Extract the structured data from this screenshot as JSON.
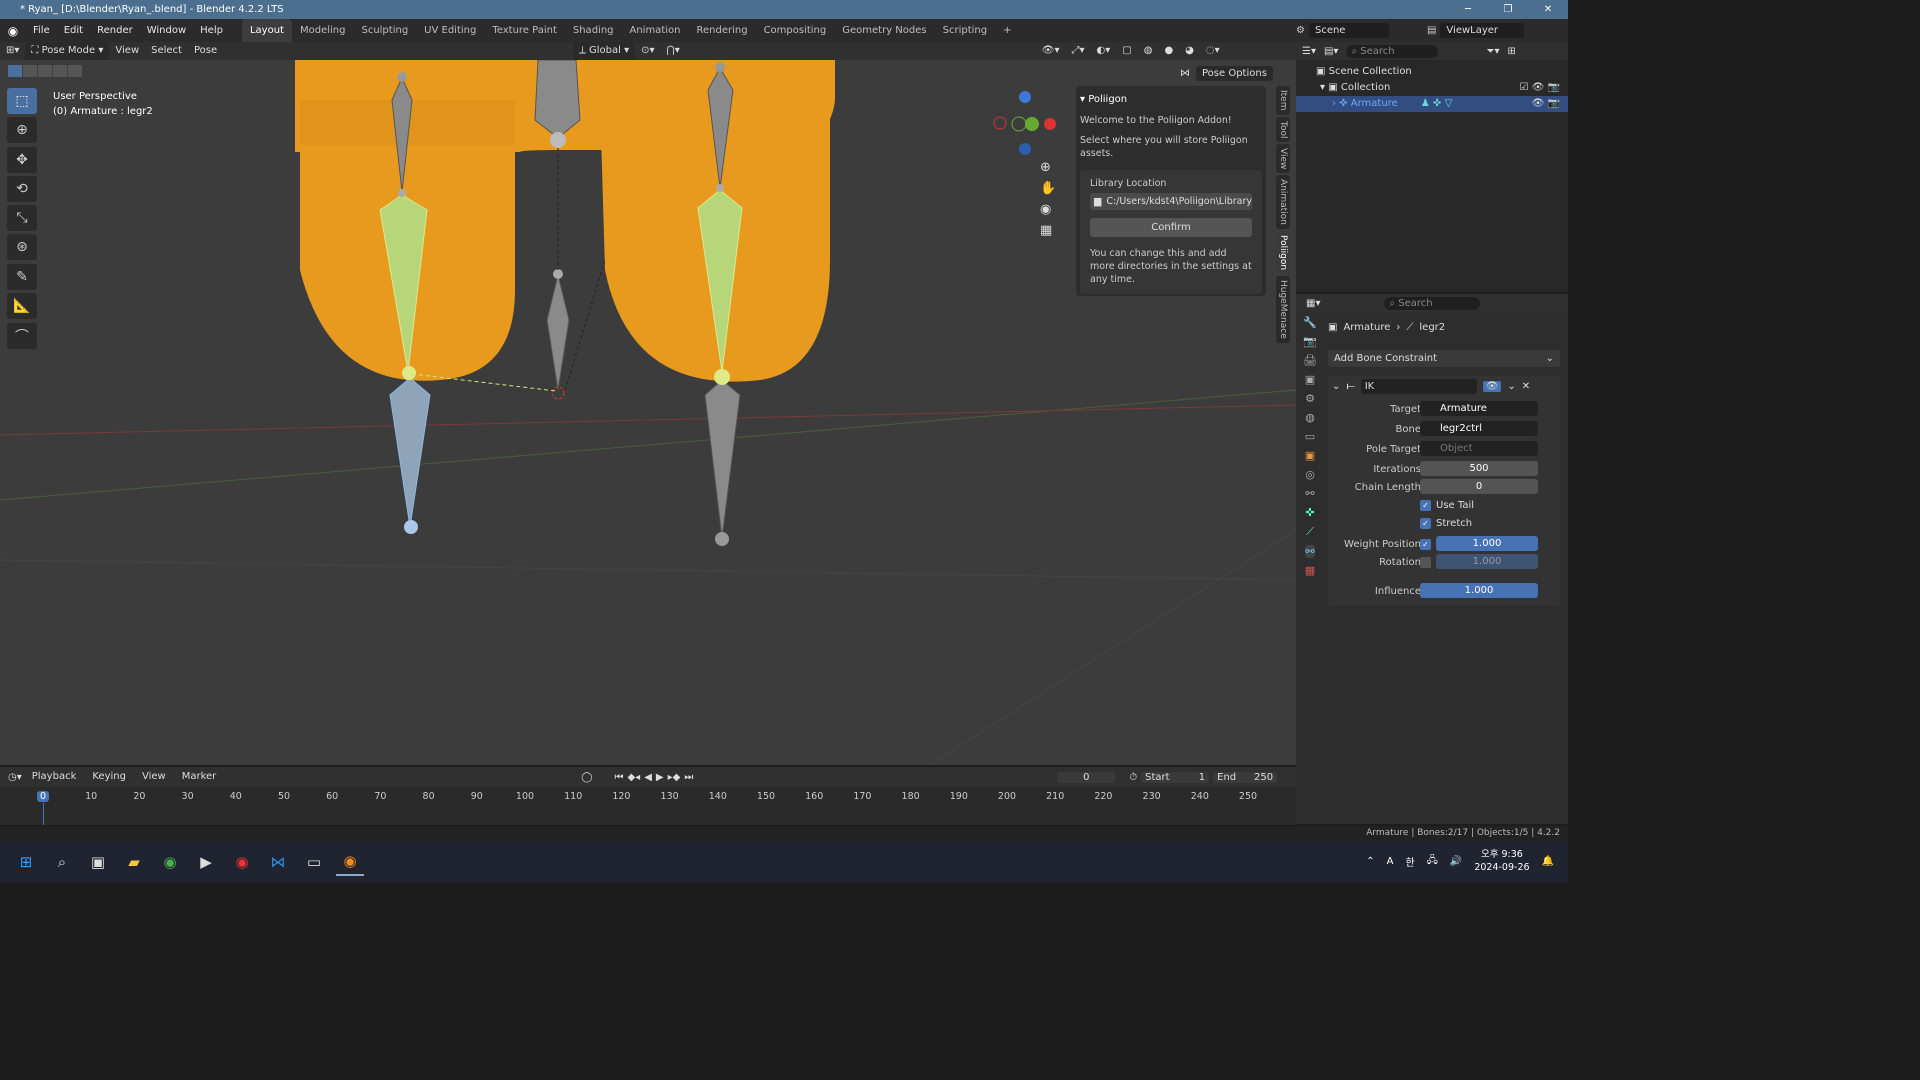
{
  "titlebar": {
    "title": "* Ryan_ [D:\\Blender\\Ryan_.blend] - Blender 4.2.2 LTS",
    "min": "─",
    "max": "❐",
    "close": "✕"
  },
  "menu": [
    "File",
    "Edit",
    "Render",
    "Window",
    "Help"
  ],
  "workspaces": [
    "Layout",
    "Modeling",
    "Sculpting",
    "UV Editing",
    "Texture Paint",
    "Shading",
    "Animation",
    "Rendering",
    "Compositing",
    "Geometry Nodes",
    "Scripting",
    "+"
  ],
  "top_right": {
    "scene": "Scene",
    "viewlayer": "ViewLayer"
  },
  "vp_header": {
    "mode": "Pose Mode",
    "items": [
      "View",
      "Select",
      "Pose"
    ],
    "orientation": "Global",
    "pose_options": "Pose Options"
  },
  "viewport": {
    "perspective": "User Perspective",
    "object": "(0) Armature : legr2"
  },
  "npanel": {
    "title": "Poliigon",
    "welcome": "Welcome to the Poliigon Addon!",
    "select_text": "Select where you will store Poliigon assets.",
    "lib_label": "Library Location",
    "lib_path": "C:/Users/kdst4\\Poliigon\\Library",
    "confirm": "Confirm",
    "footer": "You can change this and add more directories in the settings at any time.",
    "tabs": [
      "Item",
      "Tool",
      "View",
      "Animation",
      "Poliigon",
      "HugeMenace"
    ]
  },
  "outliner": {
    "search": "Search",
    "scene_collection": "Scene Collection",
    "collection": "Collection",
    "armature": "Armature"
  },
  "props": {
    "search": "Search",
    "breadcrumb_obj": "Armature",
    "breadcrumb_bone": "legr2",
    "add_constraint": "Add Bone Constraint",
    "constraint_name": "IK",
    "target_label": "Target",
    "target": "Armature",
    "bone_label": "Bone",
    "bone": "legr2ctrl",
    "pole_label": "Pole Target",
    "pole": "Object",
    "iterations_label": "Iterations",
    "iterations": "500",
    "chain_label": "Chain Length",
    "chain": "0",
    "use_tail": "Use Tail",
    "stretch": "Stretch",
    "weight_pos_label": "Weight Position",
    "weight_pos": "1.000",
    "rotation_label": "Rotation",
    "rotation": "1.000",
    "influence_label": "Influence",
    "influence": "1.000"
  },
  "timeline": {
    "menus": [
      "Playback",
      "Keying",
      "View",
      "Marker"
    ],
    "current": "0",
    "start_label": "Start",
    "start": "1",
    "end_label": "End",
    "end": "250",
    "ticks": [
      "0",
      "10",
      "20",
      "30",
      "40",
      "50",
      "60",
      "70",
      "80",
      "90",
      "100",
      "110",
      "120",
      "130",
      "140",
      "150",
      "160",
      "170",
      "180",
      "190",
      "200",
      "210",
      "220",
      "230",
      "240",
      "250"
    ]
  },
  "status": "Armature | Bones:2/17 | Objects:1/5 | 4.2.2",
  "taskbar": {
    "time": "오후 9:36",
    "date": "2024-09-26",
    "ime": "A",
    "hangul": "한"
  },
  "colors": {
    "orange": "#e79a1d",
    "bone_grey": "#8a8a8a",
    "bone_select": "#b7d67a",
    "bone_active": "#8cb8e0"
  }
}
